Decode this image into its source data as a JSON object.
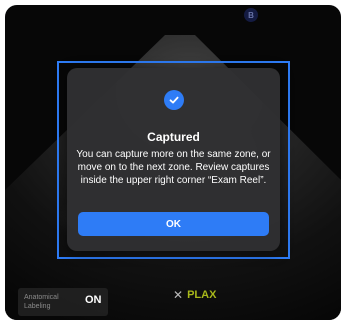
{
  "dialog": {
    "title": "Captured",
    "message": "You can capture more on the same zone, or move on to the next zone. Review captures inside the upper right corner “Exam Reel”.",
    "ok_label": "OK",
    "icon": "checkmark-circle-icon"
  },
  "overlay": {
    "marker": "B",
    "anatomical_labeling": {
      "label": "Anatomical Labeling",
      "state": "ON"
    },
    "view": {
      "close_glyph": "✕",
      "label": "PLAX"
    }
  },
  "colors": {
    "accent": "#2e7cf6",
    "dialog_bg": "#303032",
    "view_label": "#a8b81a"
  }
}
